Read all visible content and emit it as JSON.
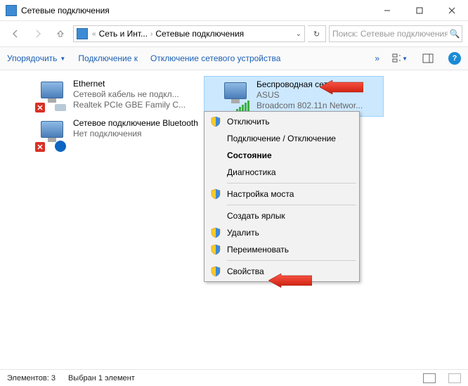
{
  "window": {
    "title": "Сетевые подключения"
  },
  "address": {
    "seg1": "Сеть и Инт...",
    "seg2": "Сетевые подключения"
  },
  "search": {
    "placeholder": "Поиск: Сетевые подключения"
  },
  "toolbar": {
    "organize": "Упорядочить",
    "connect": "Подключение к",
    "disable": "Отключение сетевого устройства"
  },
  "connections": {
    "ethernet": {
      "name": "Ethernet",
      "status": "Сетевой кабель не подкл...",
      "adapter": "Realtek PCIe GBE Family C..."
    },
    "wifi": {
      "name": "Беспроводная сеть",
      "status": "ASUS",
      "adapter": "Broadcom 802.11n Networ..."
    },
    "bluetooth": {
      "name": "Сетевое подключение Bluetooth",
      "status": "Нет подключения"
    }
  },
  "context_menu": {
    "disable": "Отключить",
    "connect_disconnect": "Подключение / Отключение",
    "status": "Состояние",
    "diagnostics": "Диагностика",
    "bridge": "Настройка моста",
    "shortcut": "Создать ярлык",
    "delete": "Удалить",
    "rename": "Переименовать",
    "properties": "Свойства"
  },
  "statusbar": {
    "elements": "Элементов: 3",
    "selected": "Выбран 1 элемент"
  }
}
